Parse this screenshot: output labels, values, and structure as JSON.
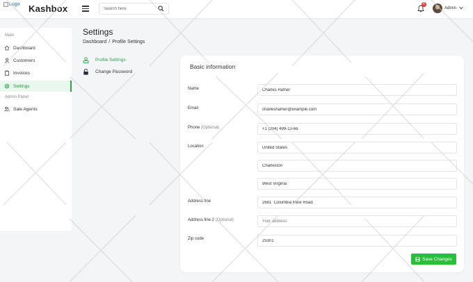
{
  "header": {
    "logo_alt": "Logo",
    "brand": "Kashbox",
    "search_placeholder": "Search here",
    "notification_count": "6",
    "user_name": "Admin"
  },
  "sidebar": {
    "section_main": "Main",
    "section_admin": "Admin Panel",
    "items": [
      {
        "label": "Dashboard",
        "icon": "home-icon"
      },
      {
        "label": "Customers",
        "icon": "user-icon"
      },
      {
        "label": "Invoices",
        "icon": "clipboard-icon"
      },
      {
        "label": "Settings",
        "icon": "gear-icon",
        "active": true
      },
      {
        "label": "Sale Agents",
        "icon": "users-icon"
      }
    ]
  },
  "page": {
    "title": "Settings",
    "breadcrumb": [
      "Dashboard",
      "Profile Settings"
    ],
    "breadcrumb_sep": "/"
  },
  "subnav": [
    {
      "label": "Profile Settings",
      "active": true
    },
    {
      "label": "Change Password",
      "active": false
    }
  ],
  "form": {
    "title": "Basic information",
    "name_label": "Name",
    "name_value": "Charles Hafner",
    "email_label": "Email",
    "email_value": "charleshafner@example.com",
    "phone_label": "Phone",
    "optional": "(Optional)",
    "phone_value": "+1 (304) 499-13-66",
    "location_label": "Location",
    "country_value": "United States",
    "city_value": "Charleston",
    "state_value": "West Virginia",
    "address1_label": "Address line",
    "address1_value": "2681  Columbia Mine Road",
    "address2_label": "Address line 2",
    "address2_placeholder": "Your address",
    "zip_label": "Zip code",
    "zip_value": "25301",
    "save_label": "Save Changes"
  },
  "colors": {
    "accent": "#28a745",
    "button": "#28c03a",
    "badge": "#e53935"
  }
}
